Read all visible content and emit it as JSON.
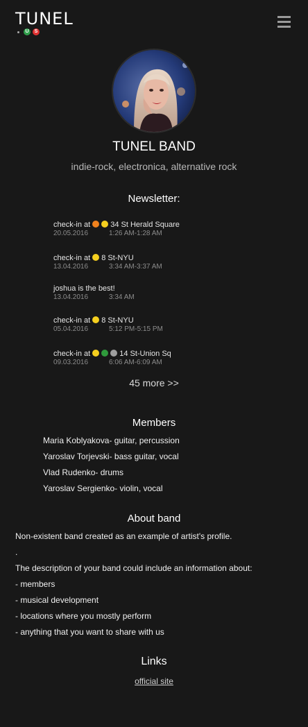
{
  "header": {
    "logo_text": "TUNEL",
    "logo_badges": [
      {
        "letter": "U",
        "color": "#2e9e4a"
      },
      {
        "letter": "S",
        "color": "#e03131"
      }
    ],
    "menu_icon": "hamburger-icon"
  },
  "profile": {
    "name": "TUNEL BAND",
    "genres": "indie-rock, electronica, alternative rock"
  },
  "newsletter": {
    "title": "Newsletter:",
    "items": [
      {
        "type": "checkin",
        "prefix": "check-in at",
        "dots": [
          "#f0811d",
          "#f5cf1f"
        ],
        "station": "34 St Herald Square",
        "date": "20.05.2016",
        "time": "1:26 AM-1:28 AM"
      },
      {
        "type": "checkin",
        "prefix": "check-in at",
        "dots": [
          "#f5cf1f"
        ],
        "station": "8 St-NYU",
        "date": "13.04.2016",
        "time": "3:34 AM-3:37 AM"
      },
      {
        "type": "message",
        "prefix": "joshua is the best!",
        "dots": [],
        "station": "",
        "date": "13.04.2016",
        "time": "3:34 AM"
      },
      {
        "type": "checkin",
        "prefix": "check-in at",
        "dots": [
          "#f5cf1f"
        ],
        "station": "8 St-NYU",
        "date": "05.04.2016",
        "time": "5:12 PM-5:15 PM"
      },
      {
        "type": "checkin",
        "prefix": "check-in at",
        "dots": [
          "#f5cf1f",
          "#2f9a3c",
          "#9e9e9e"
        ],
        "station": "14 St-Union Sq",
        "date": "09.03.2016",
        "time": "6:06 AM-6:09 AM"
      }
    ],
    "more_label": "45 more >>"
  },
  "members": {
    "title": "Members",
    "list": [
      "Maria Koblyakova- guitar, percussion",
      "Yaroslav Torjevski- bass guitar, vocal",
      "Vlad Rudenko- drums",
      "Yaroslav Sergienko- violin, vocal"
    ]
  },
  "about": {
    "title": "About band",
    "lines": [
      "Non-existent band created as an example of artist's profile.",
      ".",
      "The description of your band could include an information about:",
      "- members",
      "- musical development",
      "- locations where you mostly perform",
      "- anything that you want to share with us"
    ]
  },
  "links": {
    "title": "Links",
    "items": [
      {
        "label": "official site"
      }
    ]
  }
}
